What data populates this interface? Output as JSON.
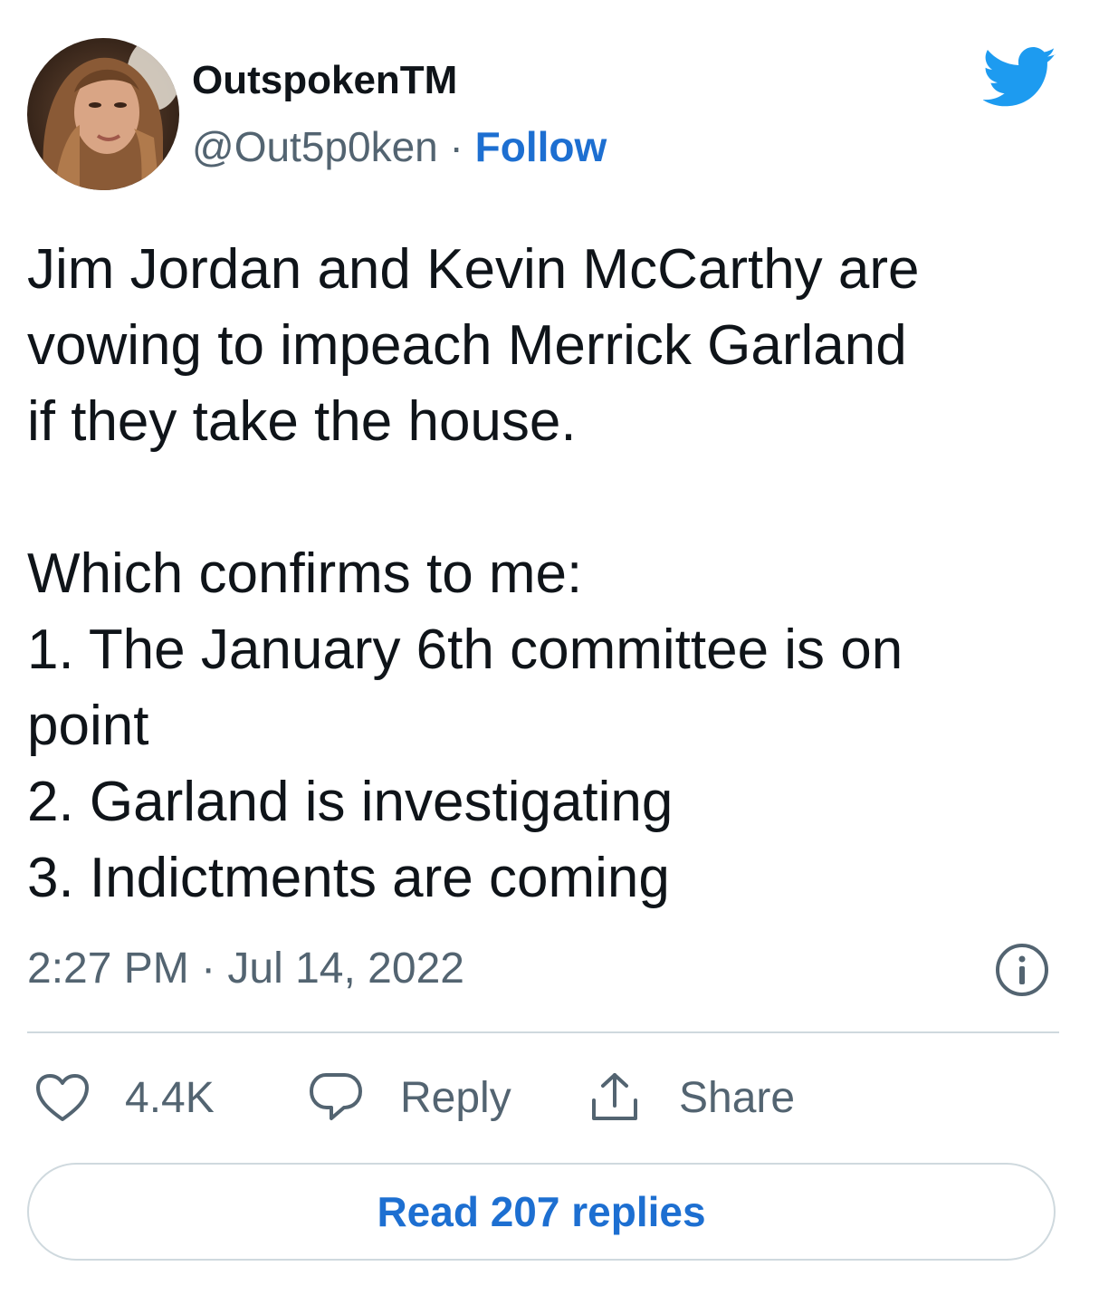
{
  "author": {
    "name": "OutspokenTM",
    "handle": "@Out5p0ken",
    "separator": "·",
    "follow_label": "Follow"
  },
  "tweet": {
    "text": "Jim Jordan and Kevin McCarthy are\nvowing to impeach Merrick Garland\nif they take the house.\n\nWhich confirms to me:\n1. The January 6th committee is on\npoint\n2. Garland is investigating\n3. Indictments are coming",
    "timestamp": "2:27 PM · Jul 14, 2022"
  },
  "actions": {
    "like_count": "4.4K",
    "reply_label": "Reply",
    "share_label": "Share"
  },
  "read_replies_label": "Read 207 replies",
  "icons": {
    "brand": "twitter-bird-icon",
    "info": "info-icon",
    "like": "heart-icon",
    "reply": "speech-bubble-icon",
    "share": "share-upload-icon"
  },
  "colors": {
    "brand_blue": "#1d9bf0",
    "link_blue": "#1d6fd1",
    "secondary_text": "#536471",
    "divider": "#cfd9de"
  }
}
